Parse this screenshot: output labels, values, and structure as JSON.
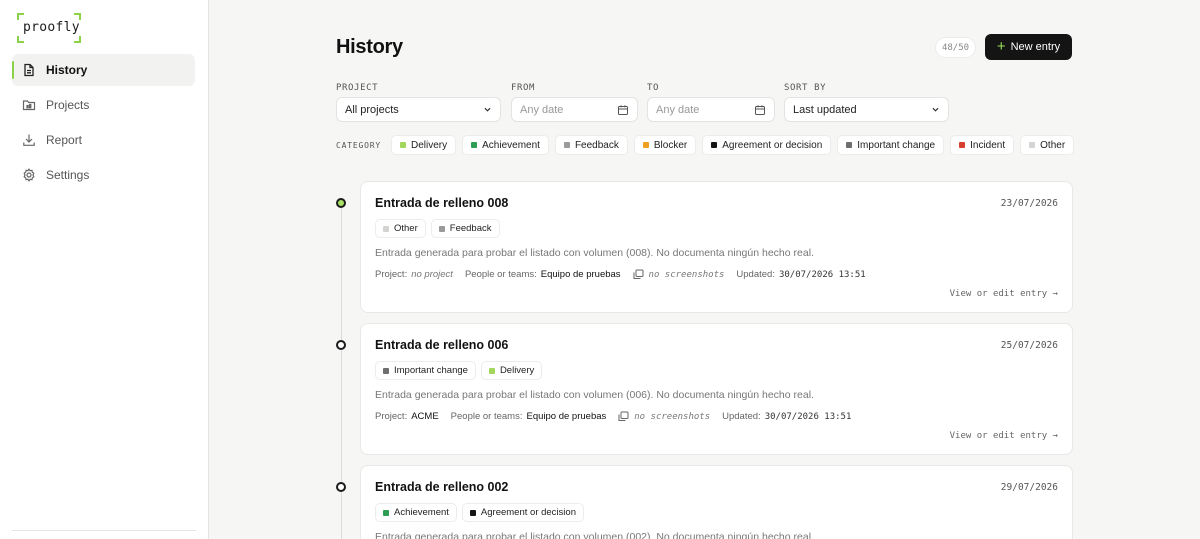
{
  "brand": {
    "name": "proofly"
  },
  "sidebar": {
    "items": [
      {
        "label": "History",
        "icon": "document-icon",
        "active": true
      },
      {
        "label": "Projects",
        "icon": "folder-icon",
        "active": false
      },
      {
        "label": "Report",
        "icon": "download-icon",
        "active": false
      },
      {
        "label": "Settings",
        "icon": "gear-icon",
        "active": false
      }
    ]
  },
  "header": {
    "title": "History",
    "counter": "48/50",
    "new_entry_label": "New entry"
  },
  "filters": {
    "project": {
      "label": "PROJECT",
      "value": "All projects"
    },
    "from": {
      "label": "FROM",
      "placeholder": "Any date"
    },
    "to": {
      "label": "TO",
      "placeholder": "Any date"
    },
    "sort": {
      "label": "SORT BY",
      "value": "Last updated"
    },
    "category_label": "CATEGORY",
    "categories": [
      {
        "label": "Delivery",
        "color": "#a3d65c"
      },
      {
        "label": "Achievement",
        "color": "#2f9e55"
      },
      {
        "label": "Feedback",
        "color": "#9a9a9a"
      },
      {
        "label": "Blocker",
        "color": "#f0a020"
      },
      {
        "label": "Agreement or decision",
        "color": "#151515"
      },
      {
        "label": "Important change",
        "color": "#6e6e6e"
      },
      {
        "label": "Incident",
        "color": "#d8402e"
      },
      {
        "label": "Other",
        "color": "#d4d4d2"
      }
    ]
  },
  "entries": [
    {
      "title": "Entrada de relleno 008",
      "date": "23/07/2026",
      "tags": [
        {
          "label": "Other",
          "color": "#d4d4d2"
        },
        {
          "label": "Feedback",
          "color": "#9a9a9a"
        }
      ],
      "description": "Entrada generada para probar el listado con volumen (008). No documenta ningún hecho real.",
      "project_label": "Project:",
      "project_value": "no project",
      "people_label": "People or teams:",
      "people_value": "Equipo de pruebas",
      "screenshots": "no screenshots",
      "updated_label": "Updated:",
      "updated_value": "30/07/2026 13:51",
      "link": "View or edit entry →"
    },
    {
      "title": "Entrada de relleno 006",
      "date": "25/07/2026",
      "tags": [
        {
          "label": "Important change",
          "color": "#6e6e6e"
        },
        {
          "label": "Delivery",
          "color": "#a3d65c"
        }
      ],
      "description": "Entrada generada para probar el listado con volumen (006). No documenta ningún hecho real.",
      "project_label": "Project:",
      "project_value": "ACME",
      "people_label": "People or teams:",
      "people_value": "Equipo de pruebas",
      "screenshots": "no screenshots",
      "updated_label": "Updated:",
      "updated_value": "30/07/2026 13:51",
      "link": "View or edit entry →"
    },
    {
      "title": "Entrada de relleno 002",
      "date": "29/07/2026",
      "tags": [
        {
          "label": "Achievement",
          "color": "#2f9e55"
        },
        {
          "label": "Agreement or decision",
          "color": "#151515"
        }
      ],
      "description": "Entrada generada para probar el listado con volumen (002). No documenta ningún hecho real."
    }
  ]
}
